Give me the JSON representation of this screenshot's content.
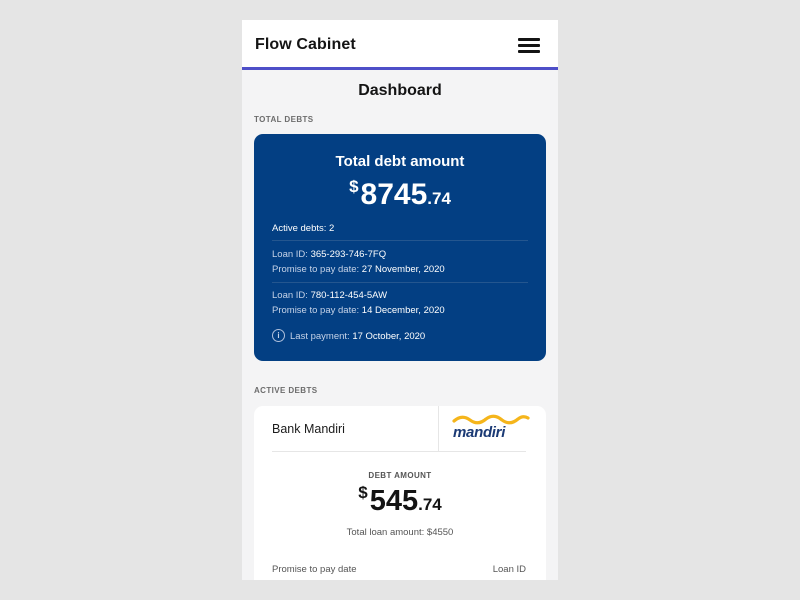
{
  "app": {
    "title": "Flow Cabinet",
    "menu_icon": "hamburger-menu-icon",
    "accent_color": "#4e4fc8"
  },
  "page": {
    "title": "Dashboard"
  },
  "total_debts": {
    "section_label": "TOTAL DEBTS",
    "card_color": "#033f83",
    "heading": "Total debt amount",
    "amount": {
      "currency": "$",
      "integer": "8745",
      "decimal": ".74"
    },
    "active_debts_label": "Active debts:",
    "active_debts_value": "2",
    "loans": [
      {
        "loan_id_label": "Loan ID:",
        "loan_id": "365-293-746-7FQ",
        "promise_label": "Promise to pay date:",
        "promise_date": "27 November, 2020"
      },
      {
        "loan_id_label": "Loan ID:",
        "loan_id": "780-112-454-5AW",
        "promise_label": "Promise to pay date:",
        "promise_date": "14 December, 2020"
      }
    ],
    "last_payment_icon": "info-icon",
    "last_payment_label": "Last payment:",
    "last_payment_date": "17 October, 2020"
  },
  "active_debts": {
    "section_label": "ACTIVE DEBTS",
    "items": [
      {
        "bank_name": "Bank Mandiri",
        "logo_text": "mandiri",
        "logo_wave_color": "#f5b51b",
        "debt_amount_label": "DEBT AMOUNT",
        "amount": {
          "currency": "$",
          "integer": "545",
          "decimal": ".74"
        },
        "total_loan_label": "Total loan amount:",
        "total_loan_value": "$4550",
        "promise_label": "Promise to pay date",
        "loan_id_label": "Loan ID"
      }
    ]
  }
}
